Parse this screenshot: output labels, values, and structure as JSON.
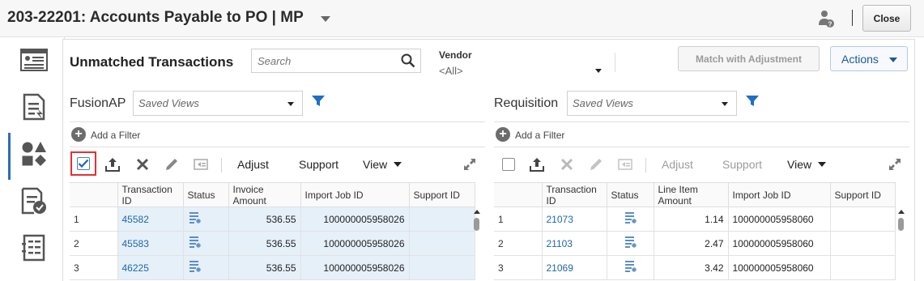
{
  "header": {
    "title": "203-22201: Accounts Payable to PO | MP",
    "close_label": "Close"
  },
  "rail": {
    "items": [
      "summary-icon",
      "transactions-icon",
      "match-icon",
      "approval-icon",
      "report-icon"
    ]
  },
  "main": {
    "title": "Unmatched Transactions",
    "search_placeholder": "Search",
    "vendor_label": "Vendor",
    "vendor_value": "<All>",
    "match_button": "Match with Adjustment",
    "actions_button": "Actions"
  },
  "left": {
    "title": "FusionAP",
    "saved_views": "Saved Views",
    "add_filter": "Add a Filter",
    "adjust": "Adjust",
    "support": "Support",
    "view": "View",
    "columns": [
      "",
      "Transaction ID",
      "Status",
      "Invoice Amount",
      "Import Job ID",
      "Support ID"
    ],
    "rows": [
      {
        "n": "1",
        "tid": "45582",
        "amount": "536.55",
        "job": "100000005958026",
        "support": ""
      },
      {
        "n": "2",
        "tid": "45583",
        "amount": "536.55",
        "job": "100000005958026",
        "support": ""
      },
      {
        "n": "3",
        "tid": "46225",
        "amount": "536.55",
        "job": "100000005958026",
        "support": ""
      }
    ]
  },
  "right": {
    "title": "Requisition",
    "saved_views": "Saved Views",
    "add_filter": "Add a Filter",
    "adjust": "Adjust",
    "support": "Support",
    "view": "View",
    "columns": [
      "",
      "Transaction ID",
      "Status",
      "Line Item Amount",
      "Import Job ID",
      "Support ID"
    ],
    "rows": [
      {
        "n": "1",
        "tid": "21073",
        "amount": "1.14",
        "job": "100000005958060",
        "support": ""
      },
      {
        "n": "2",
        "tid": "21103",
        "amount": "2.47",
        "job": "100000005958060",
        "support": ""
      },
      {
        "n": "3",
        "tid": "21069",
        "amount": "3.42",
        "job": "100000005958060",
        "support": ""
      }
    ]
  },
  "colors": {
    "accent": "#2d6db5",
    "link": "#1f68a8",
    "highlight": "#e53030",
    "selected_row": "#e6f0f9"
  }
}
